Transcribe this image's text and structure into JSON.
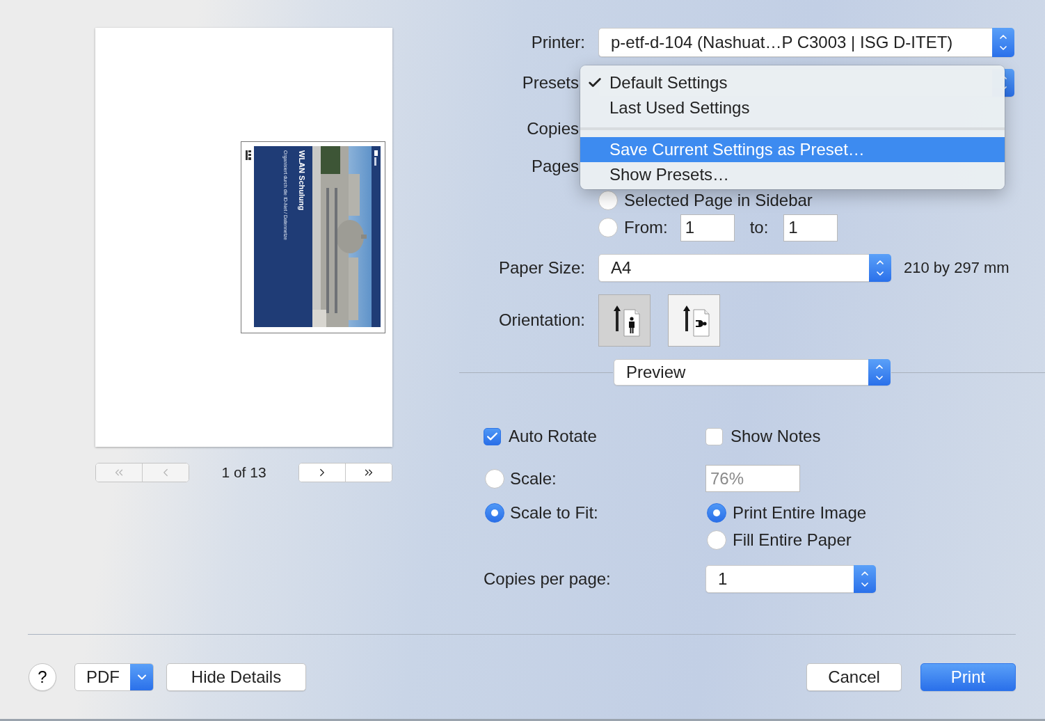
{
  "preview": {
    "document": {
      "title": "WLAN Schulung",
      "subtitle": "Organisiert durch die ID-Net / Datennetze"
    },
    "nav": [
      {
        "kind": "first",
        "disabled": true
      },
      {
        "kind": "previous",
        "disabled": true
      },
      {
        "kind": "next",
        "disabled": false
      },
      {
        "kind": "last",
        "disabled": false
      }
    ],
    "page_indicator": "1 of 13"
  },
  "printer": {
    "label": "Printer:",
    "value": "p-etf-d-104 (Nashuat…P C3003 | ISG D-ITET)"
  },
  "presets": {
    "label": "Presets",
    "menu": [
      {
        "kind": "item",
        "label": "Default Settings",
        "checked": true,
        "selected": false
      },
      {
        "kind": "item",
        "label": "Last Used Settings",
        "checked": false,
        "selected": false
      },
      {
        "kind": "separator"
      },
      {
        "kind": "item",
        "label": "Save Current Settings as Preset…",
        "checked": false,
        "selected": true
      },
      {
        "kind": "item",
        "label": "Show Presets…",
        "checked": false,
        "selected": false
      }
    ]
  },
  "copies": {
    "label": "Copies"
  },
  "pages": {
    "label": "Pages",
    "options": [
      {
        "kind": "sidebar",
        "label": "Selected Page in Sidebar",
        "selected": false
      },
      {
        "kind": "range",
        "label": "From:",
        "selected": false,
        "from": "1",
        "to_label": "to:",
        "to": "1"
      }
    ]
  },
  "paper_size": {
    "label": "Paper Size:",
    "value": "A4",
    "dimensions": "210 by 297 mm"
  },
  "orientation": {
    "label": "Orientation:",
    "options": [
      {
        "kind": "portrait",
        "selected": true
      },
      {
        "kind": "landscape",
        "selected": false
      }
    ]
  },
  "section": {
    "value": "Preview"
  },
  "preview_options": {
    "auto_rotate": {
      "label": "Auto Rotate",
      "checked": true
    },
    "show_notes": {
      "label": "Show Notes",
      "checked": false
    },
    "scale": {
      "label": "Scale:",
      "selected": false,
      "value": "76%",
      "disabled": true
    },
    "scale_to_fit": {
      "label": "Scale to Fit:",
      "selected": true,
      "options": [
        {
          "label": "Print Entire Image",
          "selected": true
        },
        {
          "label": "Fill Entire Paper",
          "selected": false
        }
      ]
    },
    "copies_per_page": {
      "label": "Copies per page:",
      "value": "1"
    }
  },
  "footer": {
    "help": "?",
    "pdf": "PDF",
    "hide_details": "Hide Details",
    "cancel": "Cancel",
    "print": "Print"
  }
}
